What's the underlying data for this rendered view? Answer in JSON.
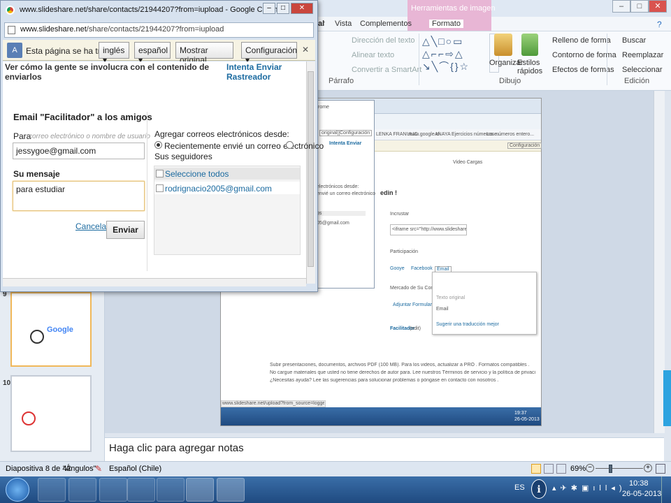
{
  "chrome": {
    "title": "www.slideshare.net/share/contacts/21944207?from=iupload - Google Chrome",
    "url_host": "www.slideshare.net",
    "url_path": "/share/contacts/21944207?from=iupload",
    "translate": {
      "message": "Esta página se ha tr...",
      "from_lang": "inglés",
      "to_lang": "español",
      "show_original": "Mostrar original",
      "settings": "Configuración"
    },
    "page": {
      "header_text": "Ver cómo la gente se involucra con el contenido de enviarlos",
      "header_link": "Intenta Enviar Rastreador",
      "heading": "Email \"Facilitador\" a los amigos",
      "to_label": "Para",
      "to_hint": "correo electrónico o nombre de usuario",
      "to_value": "jessygoe@gmail.com",
      "message_label": "Su mensaje",
      "message_value": "para estudiar",
      "cancel": "Cancelar",
      "send": "Enviar",
      "add_from_label": "Agregar correos electrónicos desde:",
      "option_recent": "Recientemente envié un correo electrónico",
      "option_followers": "Sus seguidores",
      "select_all": "Seleccione todos",
      "contacts": [
        "rodrignacio2005@gmail.com"
      ]
    }
  },
  "ribbon": {
    "tools_tab": "Herramientas de imagen",
    "tabs": [
      "al",
      "ar",
      "Vista",
      "Complementos",
      "Formato"
    ],
    "paragraph": {
      "text_direction": "Dirección del texto",
      "align_text": "Alinear texto",
      "smartart": "Convertir a SmartArt",
      "label": "Párrafo"
    },
    "drawing": {
      "organize": "Organizar",
      "quick_styles": "Estilos rápidos",
      "shape_fill": "Relleno de forma",
      "shape_outline": "Contorno de forma",
      "shape_effects": "Efectos de formas",
      "label": "Dibujo"
    },
    "editing": {
      "find": "Buscar",
      "replace": "Reemplazar",
      "select": "Seleccionar",
      "label": "Edición"
    }
  },
  "slides": {
    "numbers": [
      "9",
      "10"
    ]
  },
  "embedded": {
    "chrome_frag": "rome",
    "btn_original": "original",
    "btn_config": "Configuración",
    "bookmarks": [
      "LENKA FRANULIC",
      "www.google.cl",
      "ANAYA",
      "Ejercicios números e...",
      "Los números entero..."
    ],
    "configuracion2": "Configuración",
    "frag_send": "Intenta Enviar",
    "video_cargas": "Video Cargas",
    "frag_edin": "edin !",
    "frag_desde": "electrónicos desde:",
    "frag_envie": "envié un correo electrónico",
    "frag_os": "os",
    "frag_mail": "05@gmail.com",
    "incrustar": "Incrustar",
    "iframe_code": "<iframe src=\"http://www.slideshare.net/slideshow/emb",
    "participacion": "Participación",
    "share_google": "Gooye",
    "share_facebook": "Facebook",
    "share_email": "Email",
    "mercado": "Mercado de Su Contenido",
    "adjuntar": "Adjuntar Formulario Conduc",
    "facilitador": "Facilitador",
    "edit": "(edit)",
    "texto_original": "Texto original",
    "email_word": "Email",
    "sugerir": "Sugerir una traducción mejor",
    "bullets": [
      "Subir presentaciones, documentos, archivos PDF (100 MB). Para los videos, actualizar a PRO . Formatos compatibles .",
      "No cargue materiales que usted no tiene derechos de autor para. Lee nuestros Términos de servicio y la política de privacidad",
      "¿Necesitas ayuda? Lee las sugerencias para solucionar problemas o póngase en contacto con nosotros ."
    ],
    "status_url": "www.slideshare.net/upload?from_source=loggedin_profile_innerpage#",
    "taskbar_time": "19:37",
    "taskbar_date": "26-05-2013"
  },
  "notes_placeholder": "Haga clic para agregar notas",
  "status": {
    "slide": "Diapositiva 8 de 42",
    "theme": "\"Ángulos\"",
    "language": "Español (Chile)",
    "zoom": "69%"
  },
  "taskbar": {
    "lang": "ES",
    "time": "10:38",
    "date": "26-05-2013"
  }
}
